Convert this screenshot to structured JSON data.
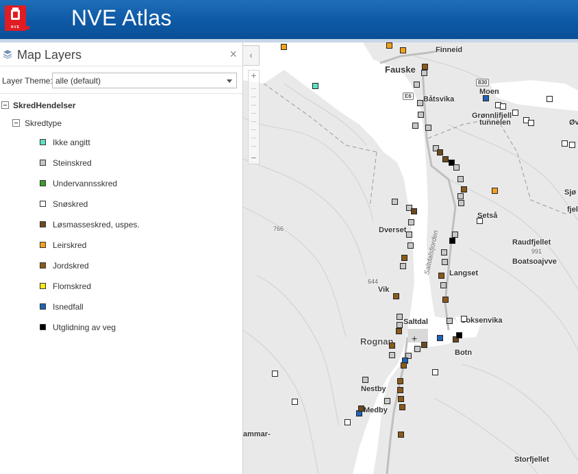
{
  "app": {
    "title": "NVE Atlas",
    "logo_text": "NVE"
  },
  "panel": {
    "title": "Map Layers",
    "close_label": "×",
    "theme_label": "Layer Theme:",
    "theme_value": "alle (default)",
    "tree_root": "SkredHendelser",
    "tree_sub": "Skredtype",
    "legend": [
      {
        "label": "Ikke angitt",
        "color": "#5fe0c6"
      },
      {
        "label": "Steinskred",
        "color": "#c8c8c8"
      },
      {
        "label": "Undervannsskred",
        "color": "#3e9a2c"
      },
      {
        "label": "Snøskred",
        "color": "#ffffff"
      },
      {
        "label": "Løsmasseskred, uspes.",
        "color": "#6b4a22"
      },
      {
        "label": "Leirskred",
        "color": "#f3a21e"
      },
      {
        "label": "Jordskred",
        "color": "#8a5a1c"
      },
      {
        "label": "Flomskred",
        "color": "#ffe81a"
      },
      {
        "label": "Isnedfall",
        "color": "#1f63b5"
      },
      {
        "label": "Utglidning av veg",
        "color": "#000000"
      }
    ]
  },
  "map": {
    "collapse_label": "‹",
    "zoom_in": "+",
    "zoom_out": "−",
    "places": {
      "finneid": "Finneid",
      "fauske": "Fauske",
      "batsvika": "Båtsvika",
      "moen": "Moen",
      "gronnlifjell": "Grønnlifjell",
      "tunnelen": "tunnelen",
      "ov": "Øv",
      "sjo": "Sjø",
      "fjel": "fjel",
      "setsa": "Setså",
      "dverset": "Dverset",
      "raudfjellet": "Raudfjellet",
      "h991": "991",
      "boatsoajvve": "Boatsoajvve",
      "h766": "766",
      "langset": "Langset",
      "h644": "644",
      "vik": "Vik",
      "saltdal": "Saltdal",
      "soksenvika": "Soksenvika",
      "rognan": "Rognan",
      "botn": "Botn",
      "nestby": "Nestby",
      "medby": "Medby",
      "hammar": "ammar-",
      "storfjellet": "Storfjellet",
      "fjord": "Saltdalsfjorden",
      "road_e6": "E6",
      "road_830": "830"
    }
  }
}
